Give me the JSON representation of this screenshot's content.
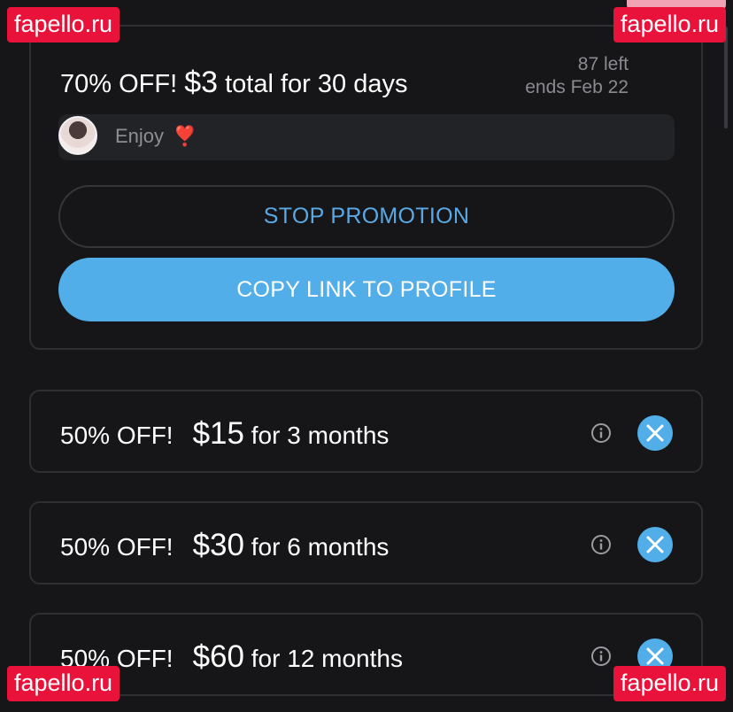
{
  "promotion": {
    "discount": "70% OFF!",
    "price": "$3",
    "terms": "total for 30 days",
    "remaining": "87 left",
    "ends": "ends Feb 22",
    "message": "Enjoy",
    "message_emoji": "❣️",
    "stop_button": "STOP PROMOTION",
    "copy_button": "COPY LINK TO PROFILE"
  },
  "offers": [
    {
      "discount": "50% OFF!",
      "price": "$15",
      "period": "for 3 months"
    },
    {
      "discount": "50% OFF!",
      "price": "$30",
      "period": "for 6 months"
    },
    {
      "discount": "50% OFF!",
      "price": "$60",
      "period": "for 12 months"
    }
  ],
  "icons": {
    "info": "info-icon",
    "close": "close-icon",
    "avatar": "avatar"
  },
  "watermark": "fapello.ru",
  "colors": {
    "background": "#161618",
    "accent": "#52aee8",
    "link": "#5aa9e6",
    "border": "#2e2f33",
    "muted_text": "#8a8b90",
    "watermark": "#e8123a"
  }
}
